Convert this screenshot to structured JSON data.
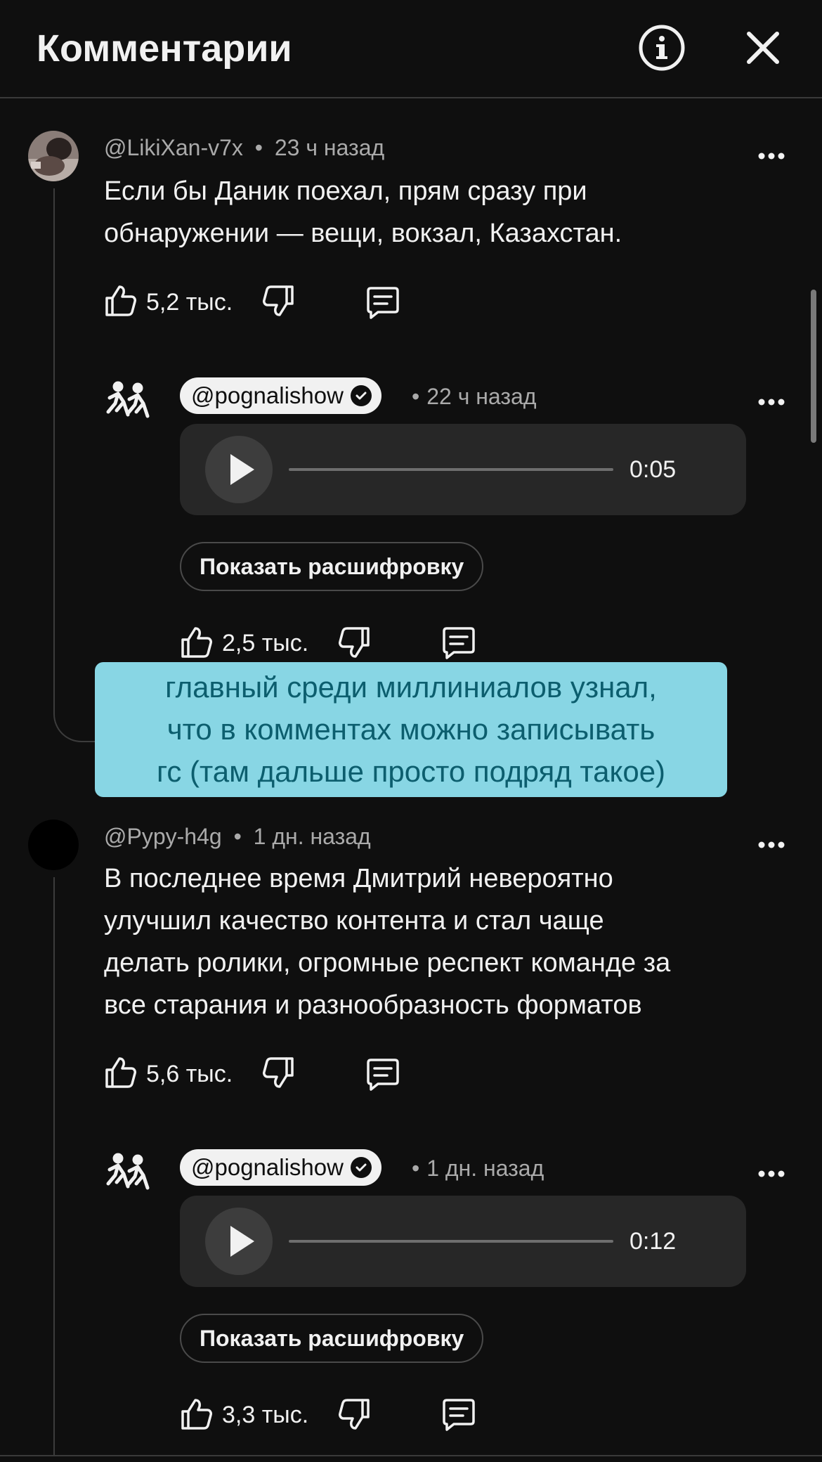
{
  "header": {
    "title": "Комментарии",
    "info_icon": "info-icon",
    "close_icon": "close-icon"
  },
  "overlay_caption": {
    "lines": [
      "главный среди миллиниалов узнал,",
      "что в комментах можно записывать",
      "гс (там дальше просто подряд такое)"
    ],
    "background": "#88d6e4",
    "text_color": "#0c5e6e"
  },
  "comments": [
    {
      "author": "@LikiXan-v7x",
      "time": "23 ч назад",
      "lines": [
        "Если бы Даник поехал, прям сразу при",
        "обнаружении — вещи, вокзал, Казахстан."
      ],
      "likes": "5,2 тыс.",
      "reply": {
        "author": "@pognalishow",
        "time": "22 ч назад",
        "duration": "0:05",
        "transcript_label": "Показать расшифровку",
        "likes": "2,5 тыс."
      }
    },
    {
      "author": "@Pypy-h4g",
      "time": "1 дн. назад",
      "lines": [
        "В последнее время Дмитрий невероятно",
        "улучшил качество контента и стал чаще",
        "делать ролики, огромные респект команде за",
        "все старания и разнообразность форматов"
      ],
      "likes": "5,6 тыс.",
      "reply": {
        "author": "@pognalishow",
        "time": "1 дн. назад",
        "duration": "0:12",
        "transcript_label": "Показать расшифровку",
        "likes": "3,3 тыс."
      }
    }
  ],
  "dot_separator": "•",
  "colors": {
    "background": "#0f0f0f",
    "text": "#f1f1f1",
    "muted": "#aaaaaa",
    "player": "#272727"
  }
}
